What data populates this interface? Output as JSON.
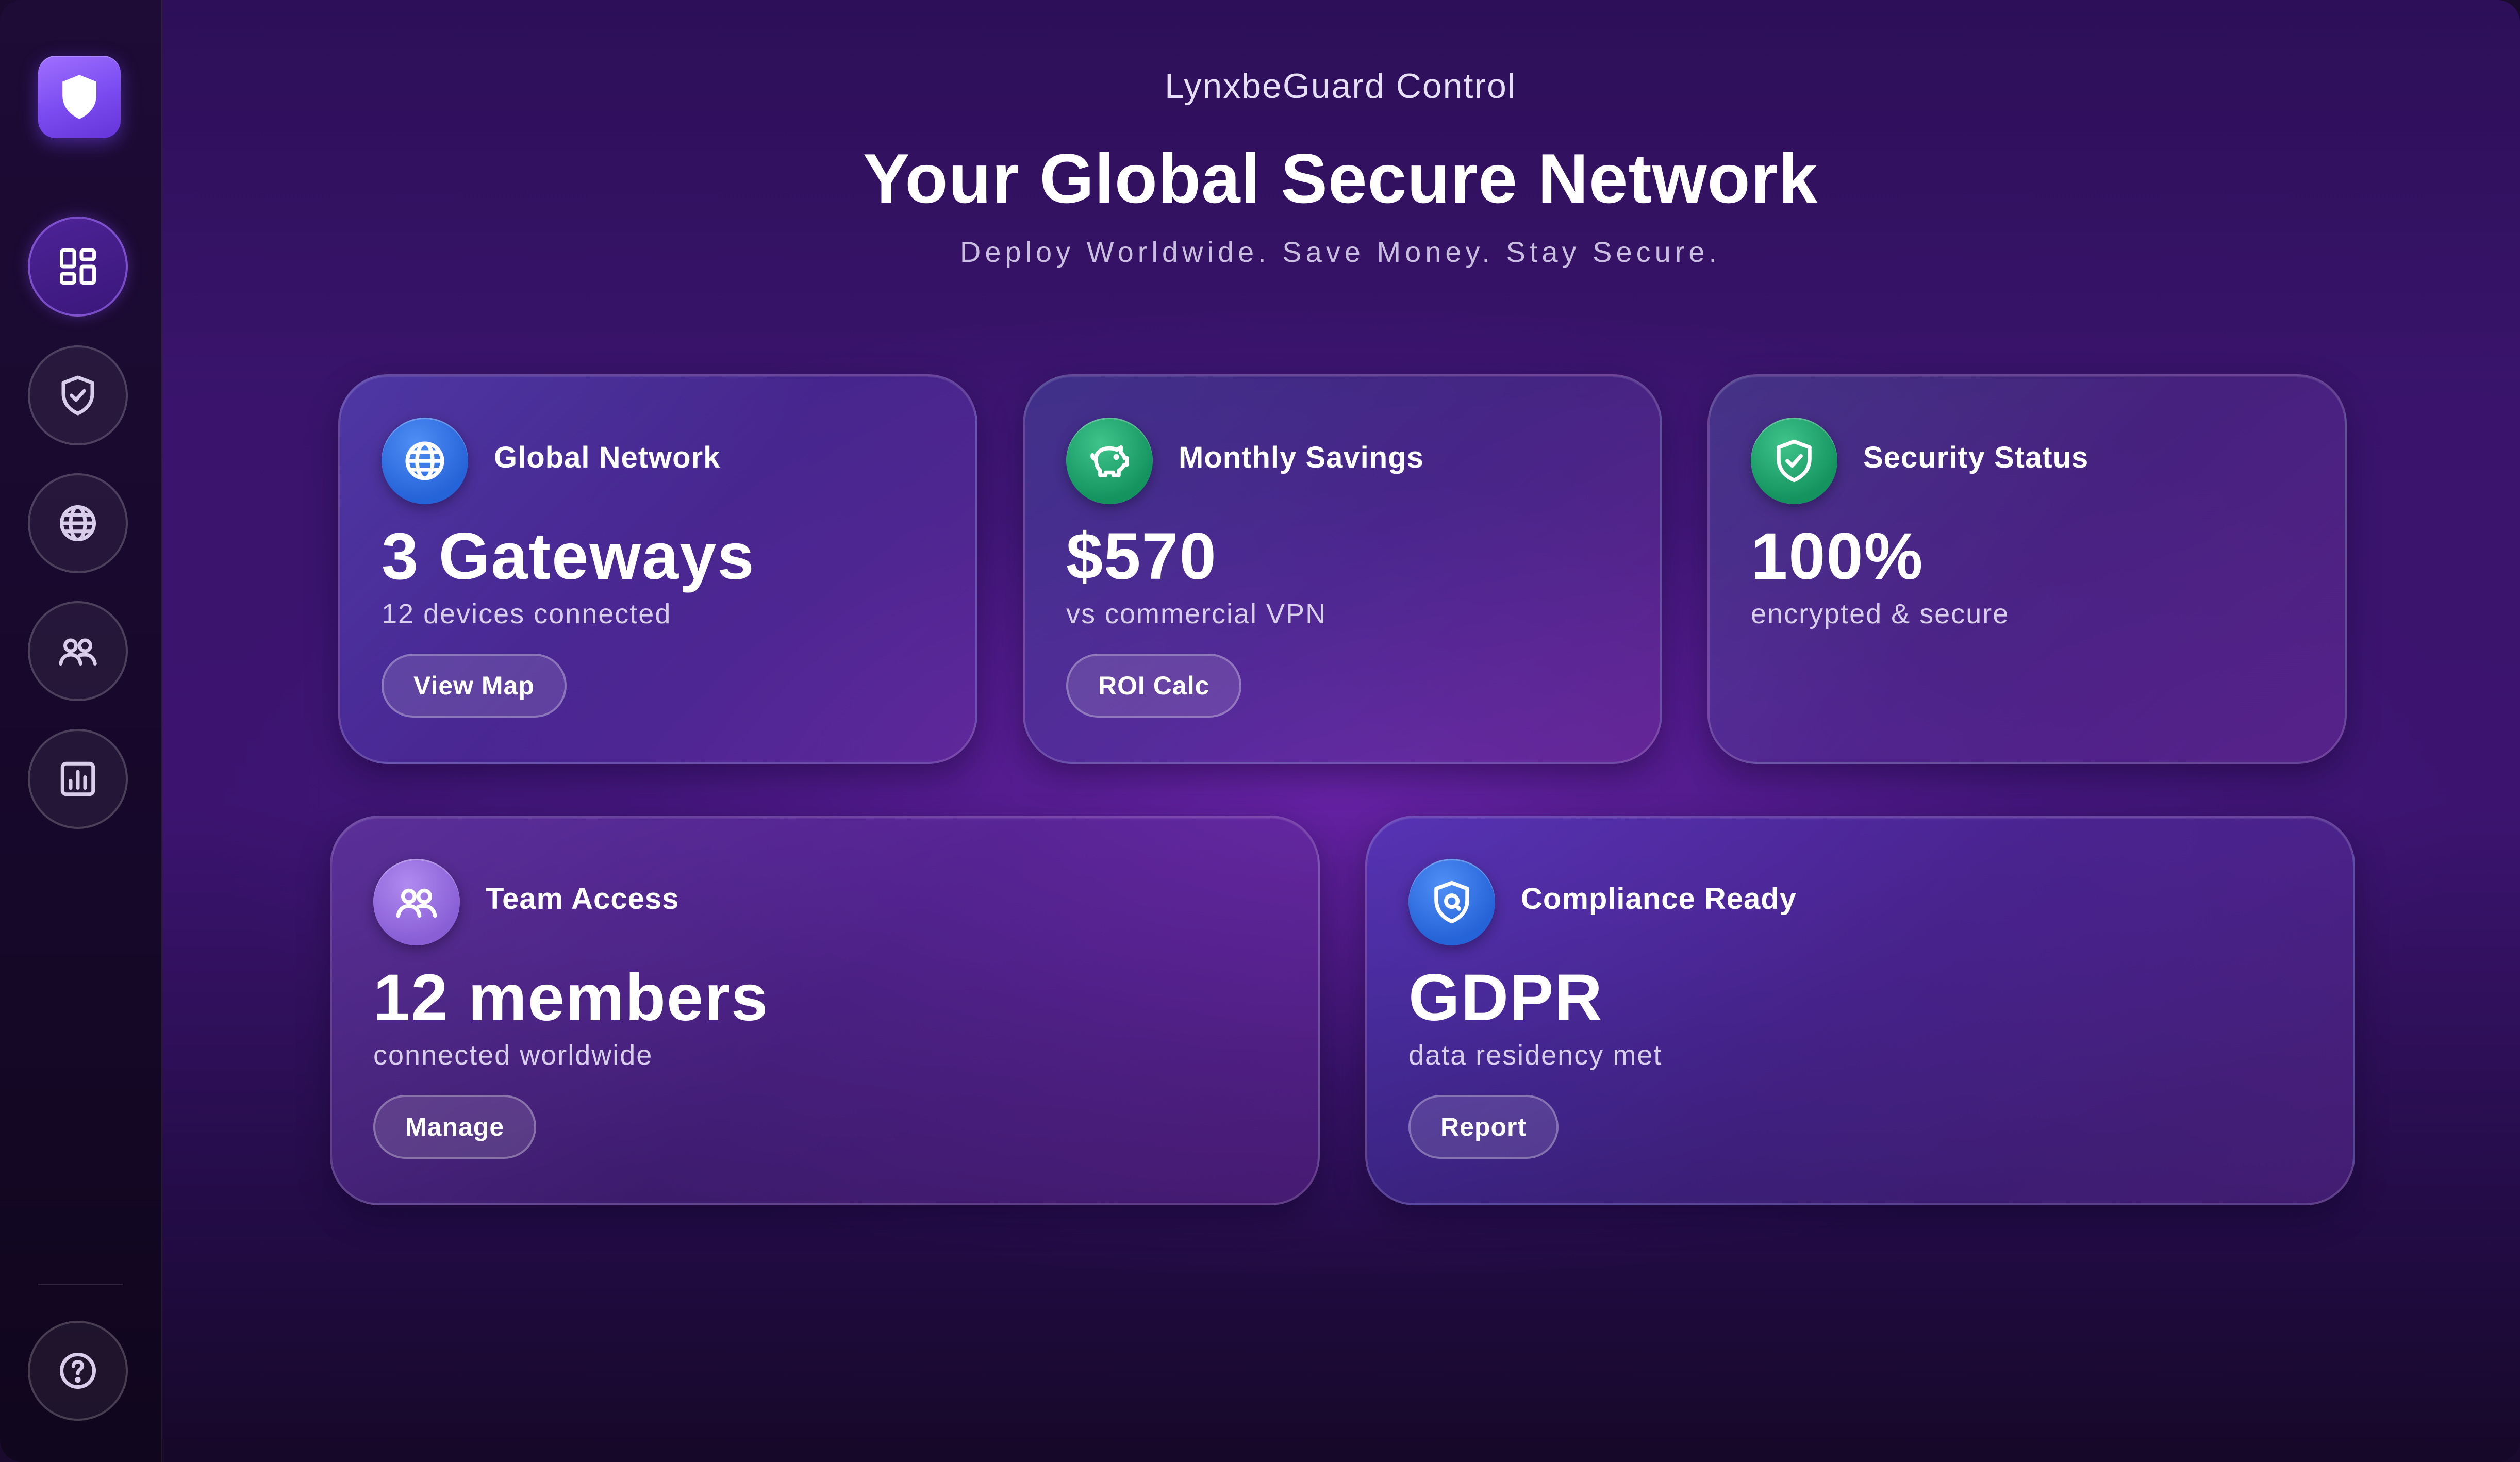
{
  "app": {
    "name": "LynxbeGuard Control"
  },
  "header": {
    "title": "Your Global Secure Network",
    "tagline": "Deploy Worldwide. Save Money. Stay Secure."
  },
  "colors": {
    "accent": "#7a4bf0",
    "blue": "#2563d8",
    "green": "#14935f",
    "purple": "#8a5fd6",
    "traffic_close": "#ff5f57",
    "traffic_min": "#febc2e"
  },
  "sidebar": {
    "logo_icon": "shield-icon",
    "items": [
      {
        "icon": "dashboard-icon",
        "active": true
      },
      {
        "icon": "shield-check-icon",
        "active": false
      },
      {
        "icon": "globe-icon",
        "active": false
      },
      {
        "icon": "team-icon",
        "active": false
      },
      {
        "icon": "analytics-icon",
        "active": false
      }
    ],
    "footer_icon": "help-icon"
  },
  "cards": {
    "network": {
      "icon": "globe-icon",
      "label": "Global Network",
      "value": "3 Gateways",
      "sub": "12 devices connected",
      "button": "View Map"
    },
    "savings": {
      "icon": "piggy-bank-icon",
      "label": "Monthly Savings",
      "value": "$570",
      "sub": "vs commercial VPN",
      "button": "ROI Calc"
    },
    "security": {
      "icon": "shield-check-icon",
      "label": "Security Status",
      "value": "100%",
      "sub": "encrypted & secure"
    },
    "team": {
      "icon": "team-icon",
      "label": "Team Access",
      "value": "12 members",
      "sub": "connected worldwide",
      "button": "Manage"
    },
    "compliance": {
      "icon": "shield-lock-icon",
      "label": "Compliance Ready",
      "value": "GDPR",
      "sub": "data residency met",
      "button": "Report"
    }
  }
}
